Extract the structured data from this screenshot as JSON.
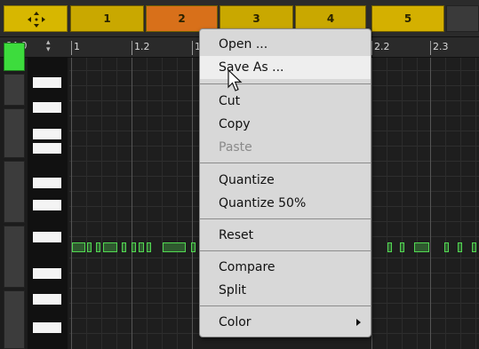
{
  "header": {
    "clips": [
      {
        "label": "1",
        "color": "#c9a800"
      },
      {
        "label": "2",
        "color": "#d8701a"
      },
      {
        "label": "3",
        "color": "#c9a800"
      },
      {
        "label": "4",
        "color": "#c9a800"
      },
      {
        "label": "5",
        "color": "#d4b000"
      }
    ]
  },
  "ruler": {
    "tempo": "64.0",
    "marks": [
      "1",
      "1.2",
      "1.3",
      "2.2",
      "2.3"
    ]
  },
  "menu": {
    "items": [
      {
        "label": "Open ...",
        "state": "normal"
      },
      {
        "label": "Save As ...",
        "state": "hover"
      },
      {
        "label": "Cut",
        "state": "normal"
      },
      {
        "label": "Copy",
        "state": "normal"
      },
      {
        "label": "Paste",
        "state": "disabled"
      },
      {
        "label": "Quantize",
        "state": "normal"
      },
      {
        "label": "Quantize 50%",
        "state": "normal"
      },
      {
        "label": "Reset",
        "state": "normal"
      },
      {
        "label": "Compare",
        "state": "normal"
      },
      {
        "label": "Split",
        "state": "normal"
      },
      {
        "label": "Color",
        "state": "submenu"
      }
    ]
  },
  "colors": {
    "accent_yellow": "#d7b700",
    "accent_orange": "#d8701a",
    "note_green": "#52d852",
    "active_pad": "#3ddc3d"
  }
}
